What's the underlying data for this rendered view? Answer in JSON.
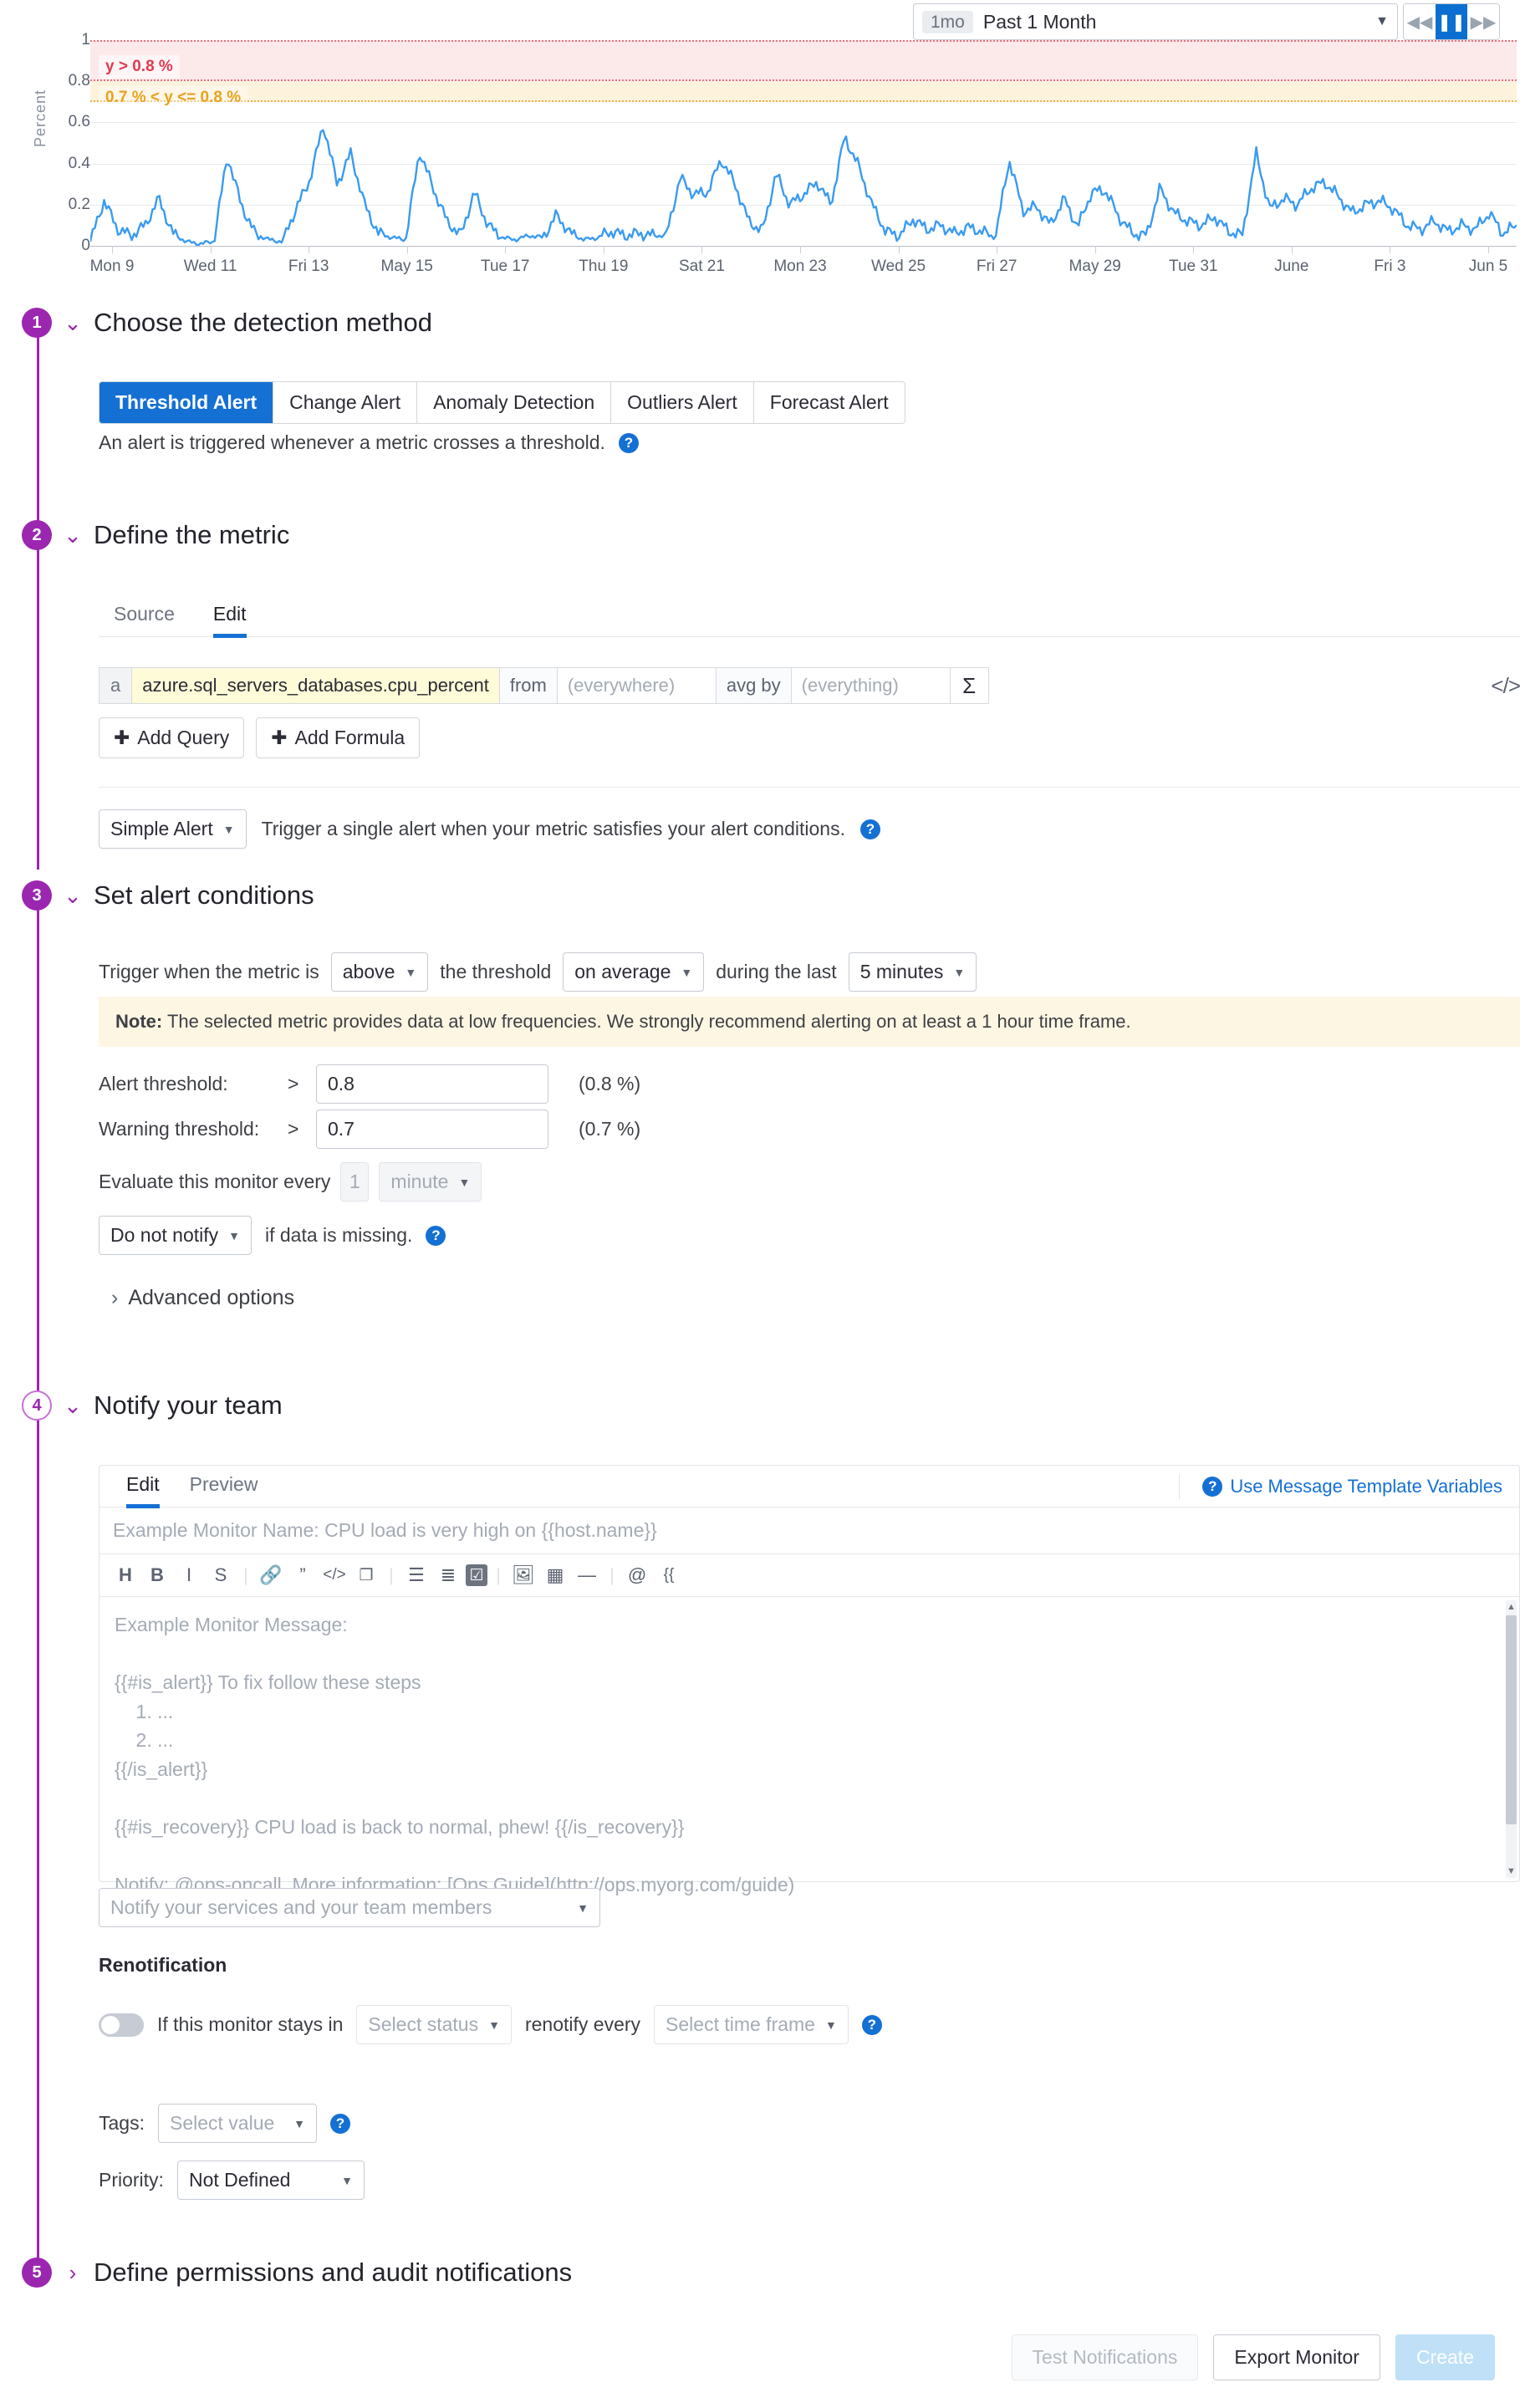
{
  "timepicker": {
    "badge": "1mo",
    "label": "Past 1 Month",
    "caret": "▼",
    "back_icon": "◀◀",
    "pause_icon": "❚❚",
    "forward_icon": "▶▶"
  },
  "chart_data": {
    "type": "line",
    "title": "",
    "xlabel": "",
    "ylabel": "Percent",
    "ylim": [
      0,
      1
    ],
    "yticks": [
      "0",
      "0.2",
      "0.4",
      "0.6",
      "0.8",
      "1"
    ],
    "xticks": [
      "Mon 9",
      "Wed 11",
      "Fri 13",
      "May 15",
      "Tue 17",
      "Thu 19",
      "Sat 21",
      "Mon 23",
      "Wed 25",
      "Fri 27",
      "May 29",
      "Tue 31",
      "June",
      "Fri 3",
      "Jun 5"
    ],
    "grid": true,
    "legend": "none",
    "series": [
      {
        "name": "avg:azure.sql_servers_databases.cpu_percent",
        "color": "#3a9bf0",
        "values": [
          0.02,
          0.22,
          0.08,
          0.05,
          0.1,
          0.23,
          0.06,
          0.02,
          0.01,
          0.02,
          0.44,
          0.2,
          0.06,
          0.03,
          0.02,
          0.18,
          0.32,
          0.59,
          0.3,
          0.45,
          0.2,
          0.06,
          0.04,
          0.03,
          0.46,
          0.28,
          0.12,
          0.05,
          0.26,
          0.1,
          0.04,
          0.03,
          0.05,
          0.04,
          0.15,
          0.06,
          0.03,
          0.04,
          0.07,
          0.05,
          0.06,
          0.05,
          0.05,
          0.33,
          0.25,
          0.26,
          0.42,
          0.3,
          0.12,
          0.07,
          0.35,
          0.2,
          0.25,
          0.31,
          0.2,
          0.53,
          0.39,
          0.2,
          0.07,
          0.05,
          0.13,
          0.08,
          0.1,
          0.06,
          0.09,
          0.07,
          0.04,
          0.42,
          0.17,
          0.19,
          0.1,
          0.23,
          0.09,
          0.26,
          0.27,
          0.14,
          0.06,
          0.05,
          0.28,
          0.16,
          0.12,
          0.1,
          0.14,
          0.07,
          0.05,
          0.45,
          0.18,
          0.23,
          0.2,
          0.28,
          0.31,
          0.24,
          0.16,
          0.2,
          0.22,
          0.18,
          0.1,
          0.08,
          0.12,
          0.07,
          0.1,
          0.08,
          0.16,
          0.06,
          0.1
        ]
      }
    ],
    "bands": [
      {
        "id": "alert",
        "label": "y > 0.8 %",
        "from": 0.8,
        "to": 1.0,
        "fill": "#fce9ea",
        "stroke": "#e8717f",
        "text_color": "#e03b51"
      },
      {
        "id": "warning",
        "label": "0.7 % < y <= 0.8 %",
        "from": 0.7,
        "to": 0.8,
        "fill": "#fdf2dc",
        "stroke": "#f0b04a",
        "text_color": "#e8a21f"
      }
    ]
  },
  "step1": {
    "number": "1",
    "title": "Choose the detection method",
    "chevron": "⌄",
    "methods": [
      "Threshold Alert",
      "Change Alert",
      "Anomaly Detection",
      "Outliers Alert",
      "Forecast Alert"
    ],
    "selected_method": "Threshold Alert",
    "description": "An alert is triggered whenever a metric crosses a threshold.",
    "help": "?"
  },
  "step2": {
    "number": "2",
    "title": "Define the metric",
    "chevron": "⌄",
    "tabs": [
      "Source",
      "Edit"
    ],
    "active_tab": "Edit",
    "query": {
      "letter": "a",
      "metric": "azure.sql_servers_databases.cpu_percent",
      "from_label": "from",
      "from_placeholder": "(everywhere)",
      "aggregation_label": "avg by",
      "group_placeholder": "(everything)",
      "sigma_icon": "Σ",
      "code_icon": "</>"
    },
    "add_query": "Add Query",
    "add_formula": "Add Formula",
    "plus_icon": "✚",
    "alert_type": "Simple Alert",
    "alert_type_description": "Trigger a single alert when your metric satisfies your alert conditions.",
    "help": "?"
  },
  "step3": {
    "number": "3",
    "title": "Set alert conditions",
    "chevron": "⌄",
    "trigger_prefix": "Trigger when the metric is",
    "direction": "above",
    "threshold_word": "the threshold",
    "aggregation": "on average",
    "during_word": "during the last",
    "timeframe": "5 minutes",
    "note_label": "Note:",
    "note_text": "The selected metric provides data at low frequencies. We strongly recommend alerting on at least a 1 hour time frame.",
    "alert_threshold_label": "Alert threshold:",
    "alert_threshold_op": ">",
    "alert_threshold_value": "0.8",
    "alert_threshold_unit": "(0.8 %)",
    "warning_threshold_label": "Warning threshold:",
    "warning_threshold_op": ">",
    "warning_threshold_value": "0.7",
    "warning_threshold_unit": "(0.7 %)",
    "evaluate_label": "Evaluate this monitor every",
    "evaluate_value": "1",
    "evaluate_unit": "minute",
    "missing_data_select": "Do not notify",
    "missing_data_text": "if data is missing.",
    "help": "?",
    "advanced_options": "Advanced options",
    "advanced_chevron": "›"
  },
  "step4": {
    "number": "4",
    "title": "Notify your team",
    "chevron": "⌄",
    "editor_tabs": [
      "Edit",
      "Preview"
    ],
    "editor_active_tab": "Edit",
    "template_variables_link": "Use Message Template Variables",
    "template_variables_help": "?",
    "monitor_name_placeholder": "Example Monitor Name: CPU load is very high on {{host.name}}",
    "toolbar_icons": [
      {
        "name": "heading-icon",
        "glyph": "H"
      },
      {
        "name": "bold-icon",
        "glyph": "B"
      },
      {
        "name": "italic-icon",
        "glyph": "I"
      },
      {
        "name": "strikethrough-icon",
        "glyph": "S"
      },
      {
        "name": "separator",
        "glyph": "|"
      },
      {
        "name": "link-icon",
        "glyph": "🔗"
      },
      {
        "name": "quote-icon",
        "glyph": "”"
      },
      {
        "name": "code-icon",
        "glyph": "</>"
      },
      {
        "name": "code-block-icon",
        "glyph": "❐"
      },
      {
        "name": "separator",
        "glyph": "|"
      },
      {
        "name": "bulleted-list-icon",
        "glyph": "☰"
      },
      {
        "name": "numbered-list-icon",
        "glyph": "≣"
      },
      {
        "name": "checklist-icon",
        "glyph": "☑"
      },
      {
        "name": "separator",
        "glyph": "|"
      },
      {
        "name": "image-icon",
        "glyph": "🖼"
      },
      {
        "name": "table-icon",
        "glyph": "▦"
      },
      {
        "name": "horizontal-rule-icon",
        "glyph": "—"
      },
      {
        "name": "separator",
        "glyph": "|"
      },
      {
        "name": "mention-icon",
        "glyph": "@"
      },
      {
        "name": "variable-icon",
        "glyph": "{{"
      }
    ],
    "message_placeholder_lines": [
      "Example Monitor Message:",
      "",
      "{{#is_alert}} To fix follow these steps",
      "    1. ...",
      "    2. ...",
      "{{/is_alert}}",
      "",
      "{{#is_recovery}} CPU load is back to normal, phew! {{/is_recovery}}",
      "",
      "Notify: @ops-oncall, More information: [Ops Guide](http://ops.myorg.com/guide)"
    ],
    "recipients_placeholder": "Notify your services and your team members",
    "renotification_title": "Renotification",
    "renotify_prefix": "If this monitor stays in",
    "renotify_status_placeholder": "Select status",
    "renotify_middle": "renotify every",
    "renotify_timeframe_placeholder": "Select time frame",
    "renotify_help": "?",
    "tags_label": "Tags:",
    "tags_placeholder": "Select value",
    "tags_help": "?",
    "priority_label": "Priority:",
    "priority_value": "Not Defined"
  },
  "step5": {
    "number": "5",
    "title": "Define permissions and audit notifications",
    "chevron": "›"
  },
  "footer": {
    "test_notifications": "Test Notifications",
    "export_monitor": "Export Monitor",
    "create": "Create"
  },
  "colors": {
    "accent_purple": "#9b27b0",
    "accent_blue": "#1570d4",
    "alert_red": "#e03b51",
    "warning_orange": "#e8a21f",
    "series_blue": "#3a9bf0"
  }
}
